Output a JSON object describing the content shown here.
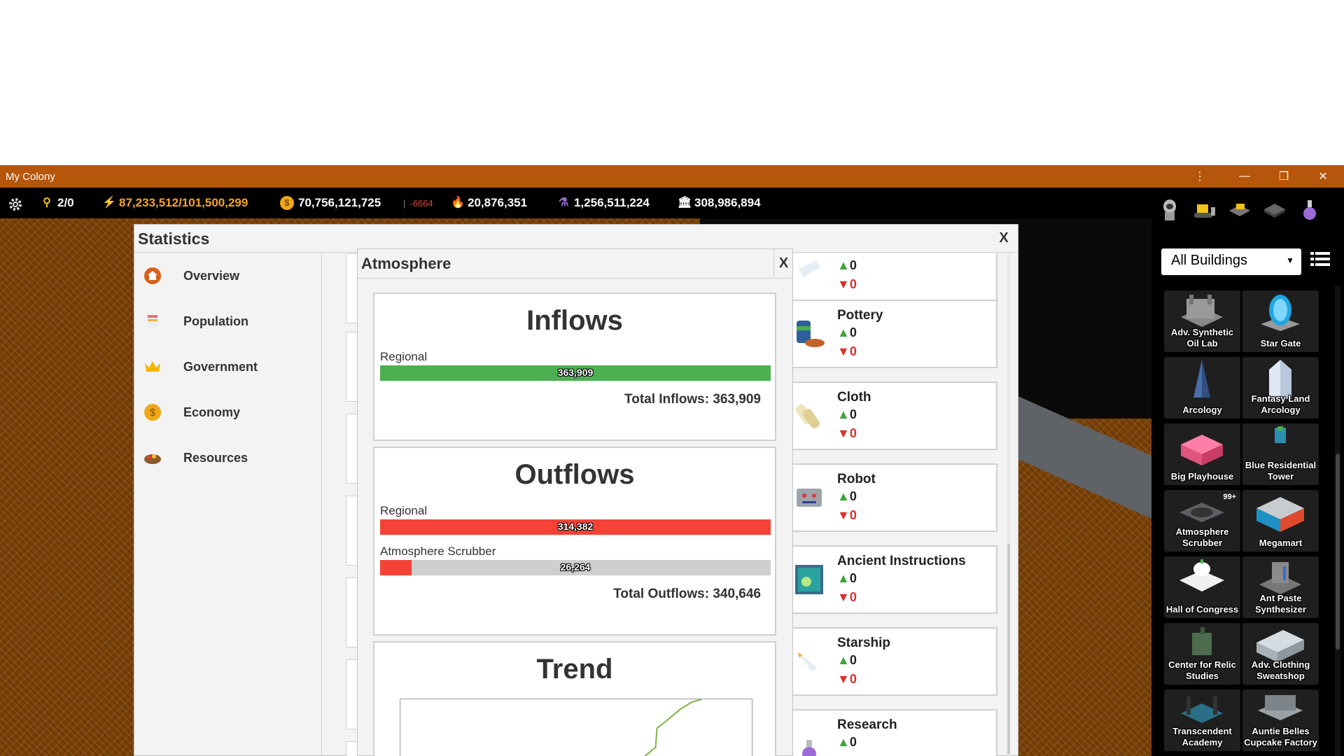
{
  "window": {
    "title": "My Colony",
    "more_icon": "more-vertical-icon",
    "minimize_icon": "minimize-icon",
    "restore_icon": "restore-icon",
    "close_icon": "close-icon"
  },
  "statsbar": {
    "settings_icon": "gear-icon",
    "keys": "2/0",
    "energy": "87,233,512/101,500,299",
    "money": "70,756,121,725",
    "money_delta": "-6664",
    "fire": "20,876,351",
    "potion": "1,256,511,224",
    "bank": "308,986,894",
    "colors": {
      "energy": "#f5a623",
      "money_delta": "#e0422c"
    }
  },
  "sidebar": {
    "tabs": [
      "astronaut-icon",
      "bulldozer-icon",
      "build-tool-icon",
      "tile-icon",
      "flask-icon"
    ],
    "select_value": "All Buildings",
    "list_icon": "list-view-icon",
    "buildings": [
      {
        "label": "Adv. Synthetic Oil Lab"
      },
      {
        "label": "Star Gate"
      },
      {
        "label": "Arcology"
      },
      {
        "label": "Fantasy Land Arcology"
      },
      {
        "label": "Big Playhouse"
      },
      {
        "label": "Blue Residential Tower"
      },
      {
        "label": "Atmosphere Scrubber",
        "badge": "99+"
      },
      {
        "label": "Megamart"
      },
      {
        "label": "Hall of Congress"
      },
      {
        "label": "Ant Paste Synthesizer"
      },
      {
        "label": "Center for Relic Studies"
      },
      {
        "label": "Adv. Clothing Sweatshop"
      },
      {
        "label": "Transcendent Academy"
      },
      {
        "label": "Auntie Belles Cupcake Factory"
      }
    ]
  },
  "statistics": {
    "title": "Statistics",
    "close": "X",
    "nav": [
      {
        "label": "Overview",
        "icon": "home-icon"
      },
      {
        "label": "Population",
        "icon": "population-icon"
      },
      {
        "label": "Government",
        "icon": "crown-icon"
      },
      {
        "label": "Economy",
        "icon": "coin-icon"
      },
      {
        "label": "Resources",
        "icon": "resources-icon"
      }
    ],
    "resources": [
      {
        "name": "",
        "up": "0",
        "down": "0",
        "icon": "paper-icon"
      },
      {
        "name": "Pottery",
        "up": "0",
        "down": "0",
        "icon": "pottery-icon"
      },
      {
        "name": "Cloth",
        "up": "0",
        "down": "0",
        "icon": "cloth-icon"
      },
      {
        "name": "Robot",
        "up": "0",
        "down": "0",
        "icon": "robot-icon"
      },
      {
        "name": "Ancient Instructions",
        "up": "0",
        "down": "0",
        "icon": "instructions-icon"
      },
      {
        "name": "Starship",
        "up": "0",
        "down": "0",
        "icon": "starship-icon"
      },
      {
        "name": "Research",
        "up": "0",
        "down": "",
        "icon": "research-icon"
      }
    ]
  },
  "atmosphere": {
    "title": "Atmosphere",
    "close": "X",
    "inflows": {
      "title": "Inflows",
      "items": [
        {
          "label": "Regional",
          "value": "363,909",
          "fraction": 1.0,
          "color": "#4caf50"
        }
      ],
      "total": "Total Inflows: 363,909"
    },
    "outflows": {
      "title": "Outflows",
      "items": [
        {
          "label": "Regional",
          "value": "314,382",
          "fraction": 1.0,
          "color": "#f44336"
        },
        {
          "label": "Atmosphere Scrubber",
          "value": "26,264",
          "fraction": 0.08,
          "color": "#f44336"
        }
      ],
      "total": "Total Outflows: 340,646"
    },
    "trend": {
      "title": "Trend",
      "line_color": "#7cb342"
    }
  }
}
